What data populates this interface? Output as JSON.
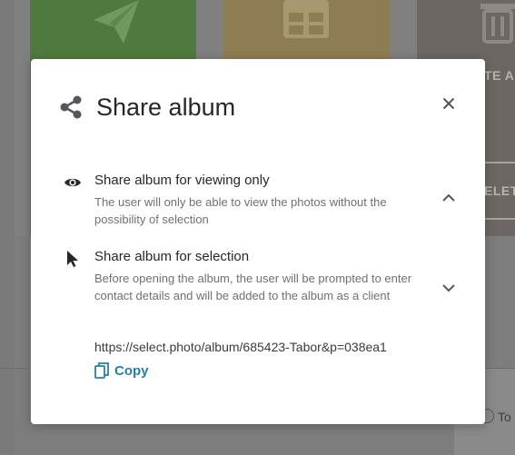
{
  "background": {
    "tile_1_text": "",
    "tile_2_text": "",
    "tile_3_text_top": "TE AL",
    "tile_3_text_bottom": "ELET",
    "radio_label": "To"
  },
  "modal": {
    "title": "Share album",
    "options": [
      {
        "icon": "eye-icon",
        "title": "Share album for viewing only",
        "description": "The user will only be able to view the photos without the possibility of selection",
        "expanded": true
      },
      {
        "icon": "pointer-icon",
        "title": "Share album for selection",
        "description": "Before opening the album, the user will be prompted to enter contact details and will be added to the album as a client",
        "expanded": false
      }
    ],
    "share_link": "https://select.photo/album/685423-Tabor&p=038ea1",
    "copy_label": "Copy"
  },
  "colors": {
    "accent": "#2a7fa0",
    "title_text": "#26272b",
    "muted_text": "#6e7077"
  }
}
